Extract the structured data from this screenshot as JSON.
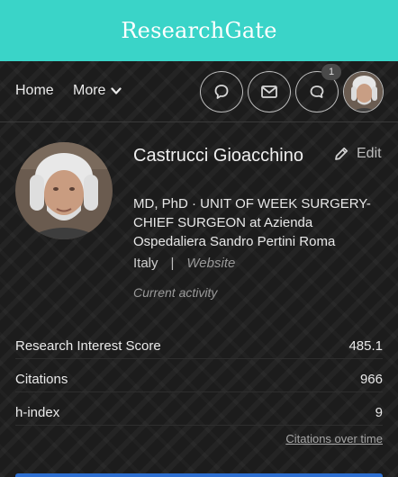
{
  "header": {
    "brand": "ResearchGate"
  },
  "nav": {
    "home": "Home",
    "more": "More",
    "badge_count": "1",
    "icons": [
      "question-icon",
      "mail-icon",
      "chat-icon"
    ]
  },
  "profile": {
    "name": "Castrucci Gioacchino",
    "edit_label": "Edit",
    "position": "MD, PhD · UNIT OF WEEK SURGERY-CHIEF SURGEON at Azienda Ospedaliera Sandro Pertini Roma",
    "country": "Italy",
    "separator": "|",
    "website": "Website",
    "current_activity": "Current activity"
  },
  "stats": [
    {
      "label": "Research Interest Score",
      "value": "485.1"
    },
    {
      "label": "Citations",
      "value": "966"
    },
    {
      "label": "h-index",
      "value": "9"
    }
  ],
  "citations_over_time": "Citations over time",
  "colors": {
    "brand": "#3ad4c8",
    "background": "#1c1c1c",
    "accent": "#2d6fd1"
  }
}
